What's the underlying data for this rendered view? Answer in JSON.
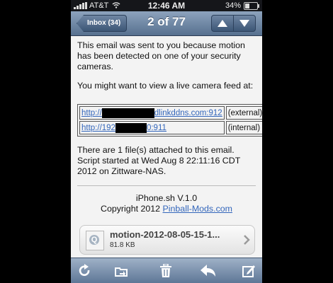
{
  "status_bar": {
    "carrier": "AT&T",
    "time": "12:46 AM",
    "battery": "34%",
    "battery_level": 0.34,
    "icons": [
      "signal-icon",
      "wifi-icon",
      "battery-icon"
    ]
  },
  "nav": {
    "back_label": "Inbox (34)",
    "title": "2 of 77",
    "icons": [
      "up-arrow-icon",
      "down-arrow-icon"
    ]
  },
  "message": {
    "para1": "This email was sent to you because motion has been detected on one of your security cameras.",
    "para2": "You might want to view a live camera feed at:",
    "links": [
      {
        "url_prefix": "http://",
        "url_suffix": "dlinkddns.com:912",
        "type": "(external)"
      },
      {
        "url_prefix": "http://192",
        "url_suffix": "0:911",
        "type": "(internal)"
      }
    ],
    "para3": "There are 1 file(s) attached to this email. Script started at Wed Aug 8 22:11:16 CDT 2012 on Zittware-NAS.",
    "signature": "iPhone.sh V.1.0",
    "copyright_prefix": "Copyright 2012",
    "copyright_link": "Pinball-Mods.com"
  },
  "attachment": {
    "name": "motion-2012-08-05-15-1...",
    "size": "81.8 KB",
    "icons": [
      "quicktime-file-icon",
      "chevron-right-icon"
    ]
  },
  "toolbar": {
    "icons": [
      "refresh-icon",
      "move-to-folder-icon",
      "trash-icon",
      "reply-icon",
      "compose-icon"
    ]
  },
  "colors": {
    "nav_bar": "#6a819f",
    "link": "#3366bb",
    "background": "#f3f3f3"
  }
}
